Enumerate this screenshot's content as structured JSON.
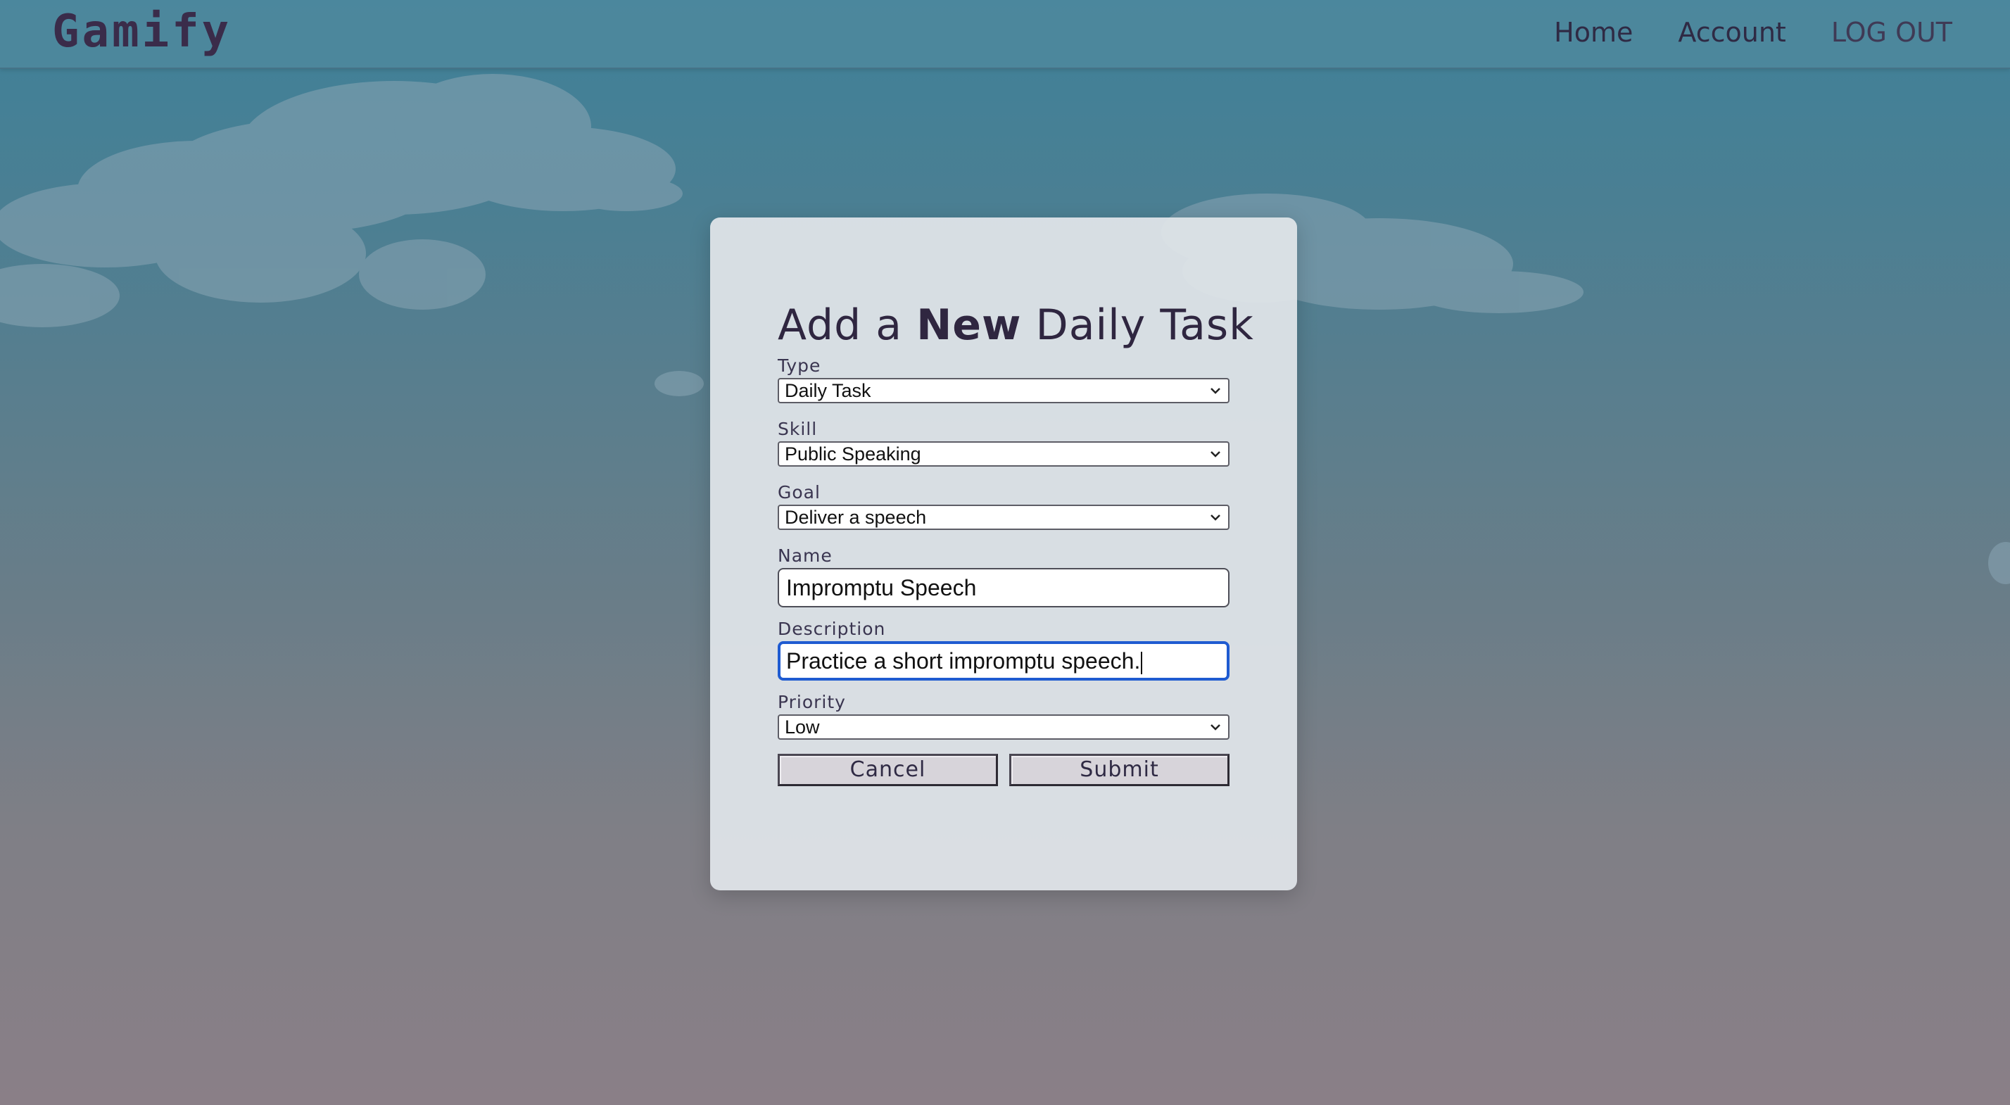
{
  "app": {
    "logo": "Gamify"
  },
  "nav": {
    "home": "Home",
    "account": "Account",
    "logout": "LOG OUT"
  },
  "form": {
    "title_part1": "Add a ",
    "title_bold": "New",
    "title_part2": " Daily Task",
    "type": {
      "label": "Type",
      "value": "Daily Task"
    },
    "skill": {
      "label": "Skill",
      "value": "Public Speaking"
    },
    "goal": {
      "label": "Goal",
      "value": "Deliver a speech"
    },
    "name": {
      "label": "Name",
      "value": "Impromptu Speech"
    },
    "description": {
      "label": "Description",
      "value": "Practice a short impromptu speech."
    },
    "priority": {
      "label": "Priority",
      "value": "Low"
    },
    "cancel_label": "Cancel",
    "submit_label": "Submit"
  },
  "colors": {
    "focus_ring": "#1f5bd1",
    "heading": "#2f2640"
  },
  "icons": {
    "select_chevron": "chevron-down-icon"
  }
}
